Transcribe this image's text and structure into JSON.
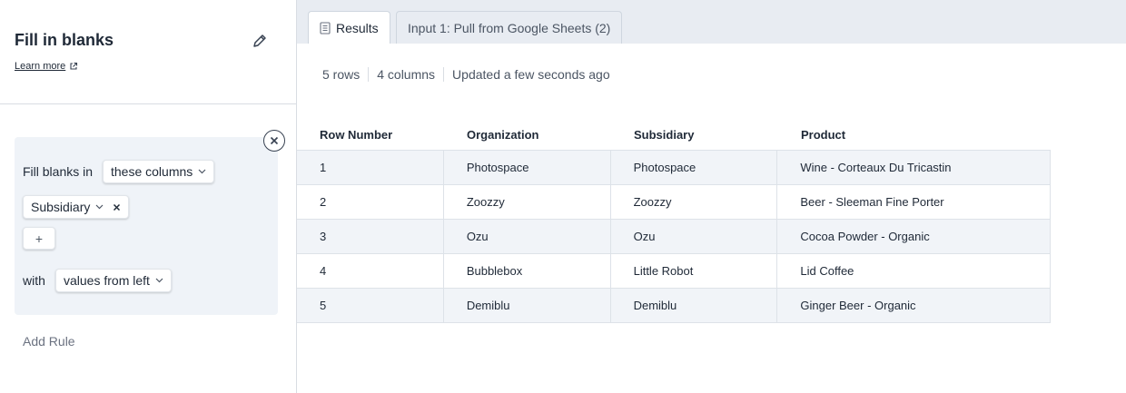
{
  "step": {
    "title": "Fill in blanks",
    "learn_more": "Learn more"
  },
  "rule": {
    "fill_label": "Fill blanks in",
    "columns_mode": "these columns",
    "selected_column": "Subsidiary",
    "plus_label": "+",
    "with_label": "with",
    "fill_method": "values from left",
    "add_rule": "Add Rule"
  },
  "tabs": [
    {
      "label": "Results",
      "active": true
    },
    {
      "label": "Input 1: Pull from Google Sheets (2)",
      "active": false
    }
  ],
  "stats": {
    "rows": "5 rows",
    "columns": "4 columns",
    "updated": "Updated a few seconds ago"
  },
  "table": {
    "headers": [
      "Row Number",
      "Organization",
      "Subsidiary",
      "Product"
    ],
    "rows": [
      [
        "1",
        "Photospace",
        "Photospace",
        "Wine - Corteaux Du Tricastin"
      ],
      [
        "2",
        "Zoozzy",
        "Zoozzy",
        "Beer - Sleeman Fine Porter"
      ],
      [
        "3",
        "Ozu",
        "Ozu",
        "Cocoa Powder - Organic"
      ],
      [
        "4",
        "Bubblebox",
        "Little Robot",
        "Lid Coffee"
      ],
      [
        "5",
        "Demiblu",
        "Demiblu",
        "Ginger Beer - Organic"
      ]
    ]
  }
}
